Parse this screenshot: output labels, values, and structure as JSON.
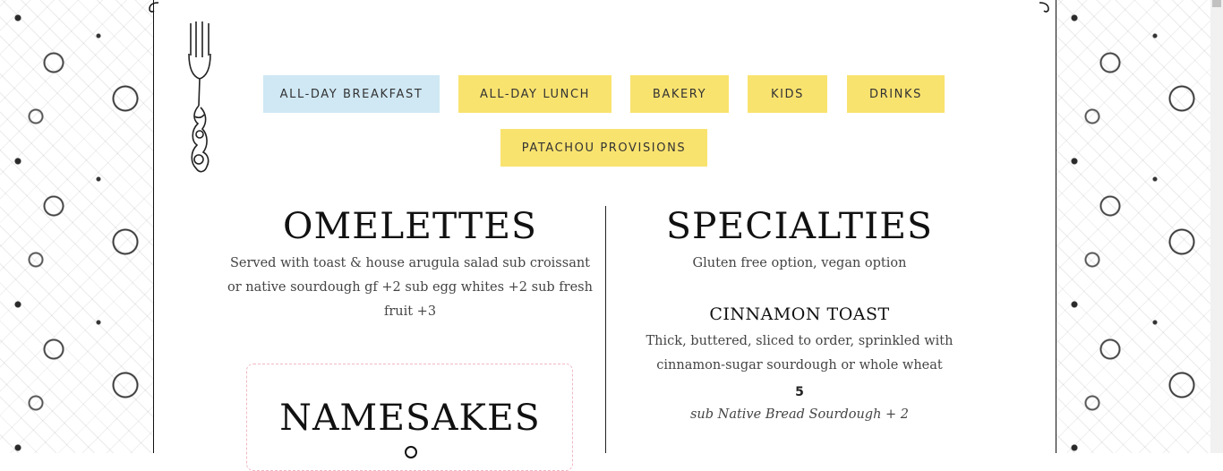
{
  "nav": {
    "tabs": [
      {
        "label": "ALL-DAY BREAKFAST",
        "active": true
      },
      {
        "label": "ALL-DAY LUNCH",
        "active": false
      },
      {
        "label": "BAKERY",
        "active": false
      },
      {
        "label": "KIDS",
        "active": false
      },
      {
        "label": "DRINKS",
        "active": false
      },
      {
        "label": "PATACHOU PROVISIONS",
        "active": false
      }
    ]
  },
  "colors": {
    "tab": "#f9e36f",
    "tab_active": "#cfe8f4",
    "namesakes_border": "#f0b8c4"
  },
  "omelettes": {
    "title": "OMELETTES",
    "description_lines": [
      "Served with toast & house arugula salad sub croissant",
      "or native sourdough gf +2 sub egg whites +2 sub fresh",
      "fruit +3"
    ]
  },
  "namesakes": {
    "title": "NAMESAKES"
  },
  "specialties": {
    "title": "SPECIALTIES",
    "note": "Gluten free option, vegan option",
    "items": [
      {
        "name": "CINNAMON TOAST",
        "description_lines": [
          "Thick, buttered, sliced to order, sprinkled with",
          "cinnamon-sugar sourdough or whole wheat"
        ],
        "price": "5",
        "sub": "sub Native Bread Sourdough + 2"
      }
    ]
  },
  "icons": [
    "fork-icon",
    "page-curl-icon"
  ]
}
